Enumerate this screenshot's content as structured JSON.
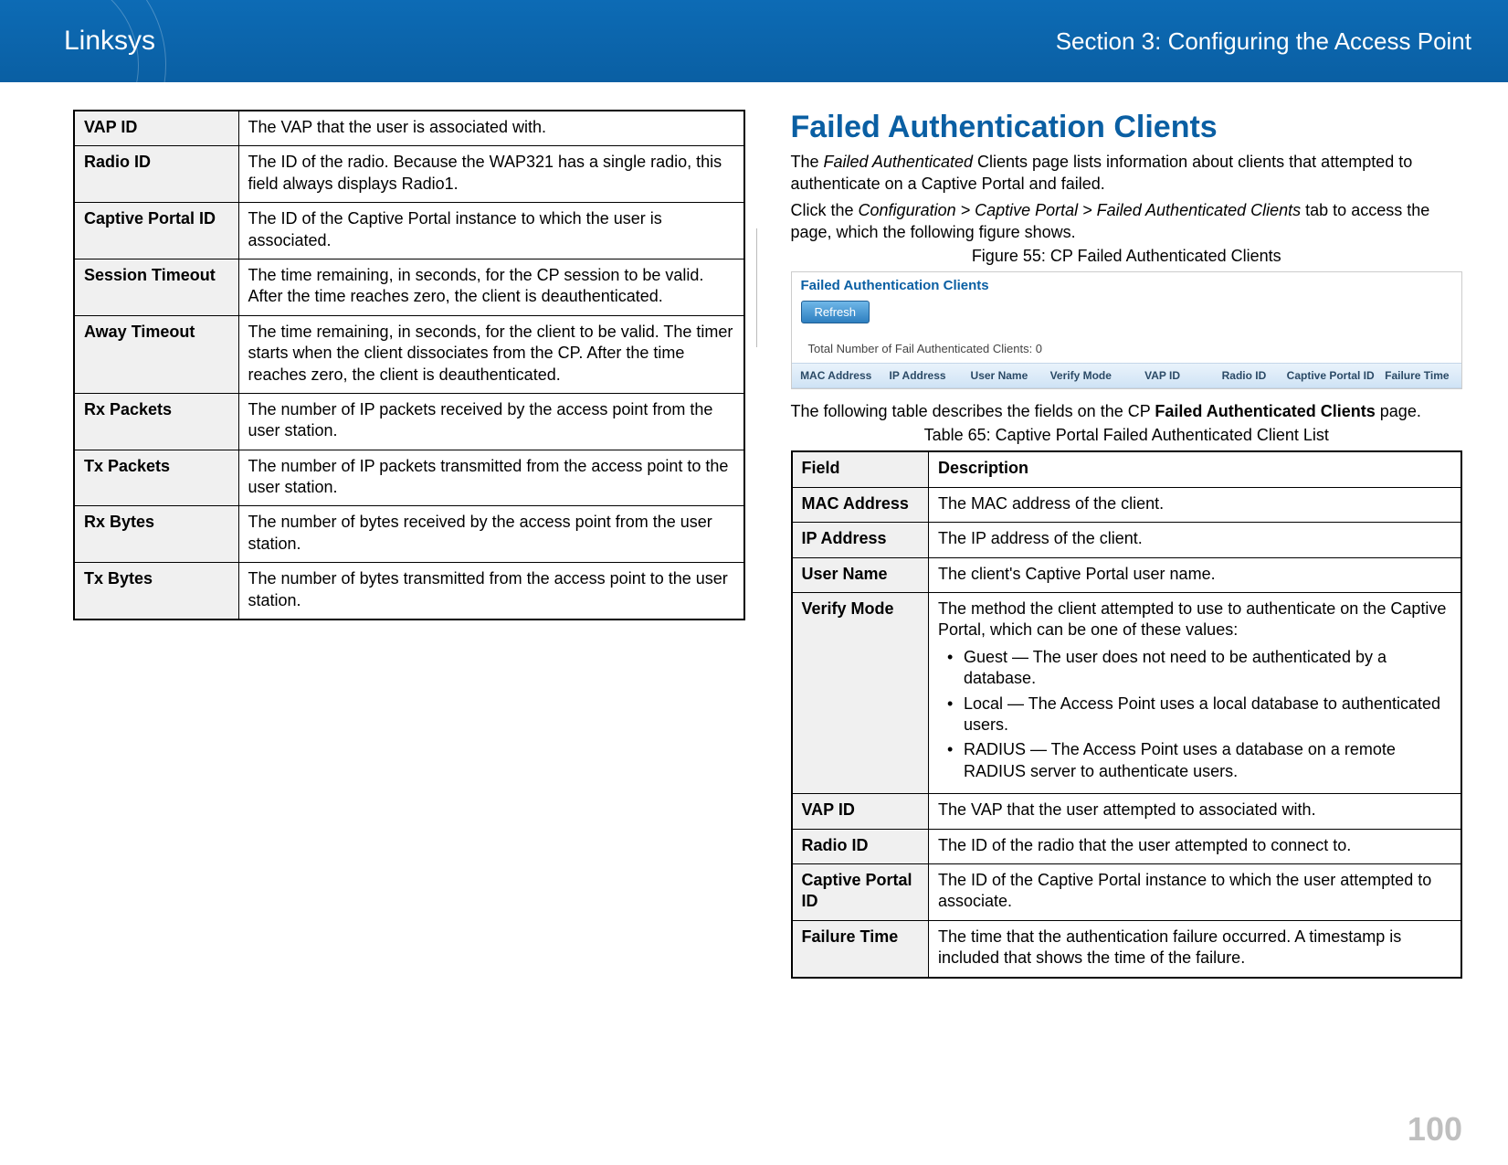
{
  "header": {
    "brand": "Linksys",
    "section": "Section 3:  Configuring the Access Point"
  },
  "left_table": {
    "rows": [
      {
        "field": "VAP ID",
        "desc": "The VAP that the user is associated with."
      },
      {
        "field": "Radio ID",
        "desc": "The ID of the radio. Because the WAP321 has a single radio, this field always displays Radio1."
      },
      {
        "field": "Captive Portal ID",
        "desc": "The ID of the Captive Portal instance to which the user is associated."
      },
      {
        "field": "Session Timeout",
        "desc": "The time remaining, in seconds, for the CP session to be valid. After the time reaches zero, the client is deauthenticated."
      },
      {
        "field": "Away Timeout",
        "desc": "The time remaining, in seconds, for the client to be valid. The timer starts when the client dissociates from the CP. After the time reaches zero, the client is deauthenticated."
      },
      {
        "field": "Rx Packets",
        "desc": "The number of IP packets received by the access point from the user station."
      },
      {
        "field": "Tx Packets",
        "desc": "The number of IP packets transmitted from the access point to the user station."
      },
      {
        "field": "Rx Bytes",
        "desc": "The number of bytes received by the access point from the user station."
      },
      {
        "field": "Tx Bytes",
        "desc": "The number of bytes transmitted from the access point to the user station."
      }
    ]
  },
  "right": {
    "heading": "Failed Authentication Clients",
    "intro_prefix": "The ",
    "intro_italic": "Failed Authenticated",
    "intro_rest": " Clients page lists information about clients that attempted to authenticate on a Captive Portal and failed.",
    "nav_prefix": "Click the ",
    "nav_italic": "Configuration > Captive Portal > Failed Authenticated Clients",
    "nav_rest": " tab to access the page, which the following figure shows.",
    "figure_caption": "Figure 55: CP Failed Authenticated Clients",
    "screenshot": {
      "title": "Failed Authentication Clients",
      "refresh": "Refresh",
      "count_label": "Total Number of Fail Authenticated Clients:   0",
      "headers": [
        "MAC Address",
        "IP Address",
        "User Name",
        "Verify Mode",
        "VAP ID",
        "Radio ID",
        "Captive Portal ID",
        "Failure Time"
      ]
    },
    "table_intro_prefix": "The following table describes the fields on the CP ",
    "table_intro_bold": "Failed Authenticated Clients",
    "table_intro_rest": " page.",
    "table_caption": "Table 65: Captive Portal Failed Authenticated Client List",
    "table_header": {
      "field": "Field",
      "desc": "Description"
    },
    "rows": [
      {
        "field": "MAC Address",
        "desc": "The MAC address of the client."
      },
      {
        "field": "IP Address",
        "desc": "The IP address of the client."
      },
      {
        "field": "User Name",
        "desc": "The client's Captive Portal user name."
      },
      {
        "field": "Verify Mode",
        "desc": "The method the client attempted to use to authenticate on the Captive Portal, which can be one of these values:",
        "bullets": [
          "Guest — The user does not need to be authenticated by a database.",
          "Local — The Access Point uses a local database to authenticated users.",
          "RADIUS — The Access Point uses a database on a remote RADIUS server to authenticate users."
        ]
      },
      {
        "field": "VAP ID",
        "desc": "The VAP that the user attempted to associated with."
      },
      {
        "field": "Radio ID",
        "desc": "The ID of the radio that the user attempted to connect to."
      },
      {
        "field": "Captive Portal ID",
        "desc": "The ID of the Captive Portal instance to which the user attempted to associate."
      },
      {
        "field": "Failure Time",
        "desc": "The time that the authentication failure occurred. A timestamp is included that shows the time of the failure."
      }
    ]
  },
  "page_number": "100"
}
